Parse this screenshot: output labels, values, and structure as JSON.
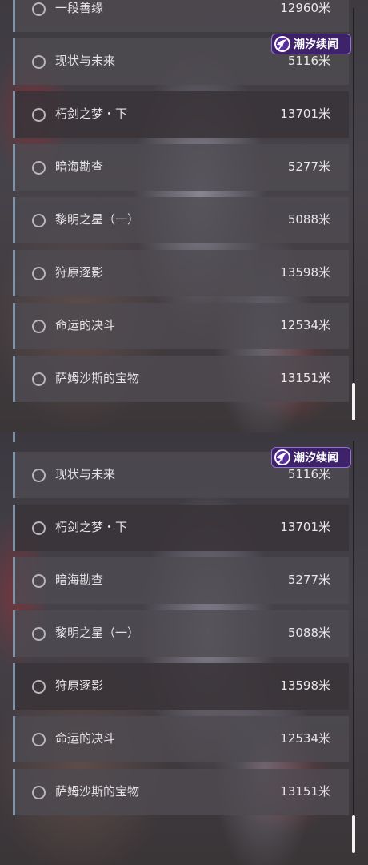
{
  "watermark": {
    "text": "潮汐续闻"
  },
  "top_panel": {
    "items": [
      {
        "name": "一段善缘",
        "distance": "12960米"
      },
      {
        "name": "现状与未来",
        "distance": "5116米"
      },
      {
        "name": "朽剑之梦・下",
        "distance": "13701米"
      },
      {
        "name": "暗海勘查",
        "distance": "5277米"
      },
      {
        "name": "黎明之星（一）",
        "distance": "5088米"
      },
      {
        "name": "狩原逐影",
        "distance": "13598米"
      },
      {
        "name": "命运的决斗",
        "distance": "12534米"
      },
      {
        "name": "萨姆沙斯的宝物",
        "distance": "13151米"
      }
    ]
  },
  "bottom_panel": {
    "items": [
      {
        "name": "现状与未来",
        "distance": "5116米"
      },
      {
        "name": "朽剑之梦・下",
        "distance": "13701米"
      },
      {
        "name": "暗海勘查",
        "distance": "5277米"
      },
      {
        "name": "黎明之星（一）",
        "distance": "5088米"
      },
      {
        "name": "狩原逐影",
        "distance": "13598米"
      },
      {
        "name": "命运的决斗",
        "distance": "12534米"
      },
      {
        "name": "萨姆沙斯的宝物",
        "distance": "13151米"
      }
    ]
  }
}
